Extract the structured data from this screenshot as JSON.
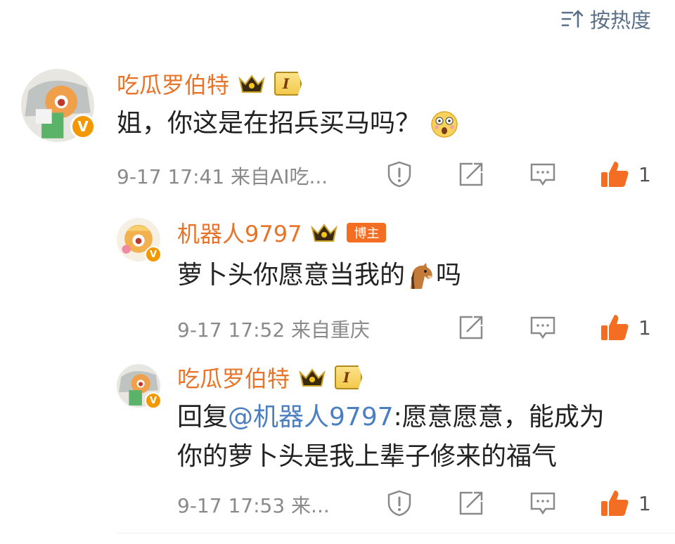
{
  "sort": {
    "label": "按热度",
    "icon": "sort-icon"
  },
  "comments": [
    {
      "user": "吃瓜罗伯特",
      "level": "I",
      "text": "姐，你这是在招兵买马吗？",
      "emoji": "astonished-face-emoji",
      "meta": "9-17 17:41  来自AI吃...",
      "likes": "1"
    },
    {
      "user": "机器人9797",
      "badge": "博主",
      "text": "萝卜头你愿意当我的",
      "emoji": "horse-emoji",
      "text_after": "吗",
      "meta": "9-17 17:52  来自重庆",
      "likes": "1"
    },
    {
      "user": "吃瓜罗伯特",
      "level": "I",
      "reply_prefix": "回复",
      "mention": "@机器人9797",
      "text_line1": ":愿意愿意，能成为",
      "text_line2": "你的萝卜头是我上辈子修来的福气",
      "meta": "9-17 17:53  来...",
      "likes": "1"
    }
  ],
  "colors": {
    "name": "#e8742a",
    "mention": "#4a7fc1",
    "meta": "#8a8a8a",
    "like": "#f36d23",
    "vbadge": "#f39800"
  }
}
